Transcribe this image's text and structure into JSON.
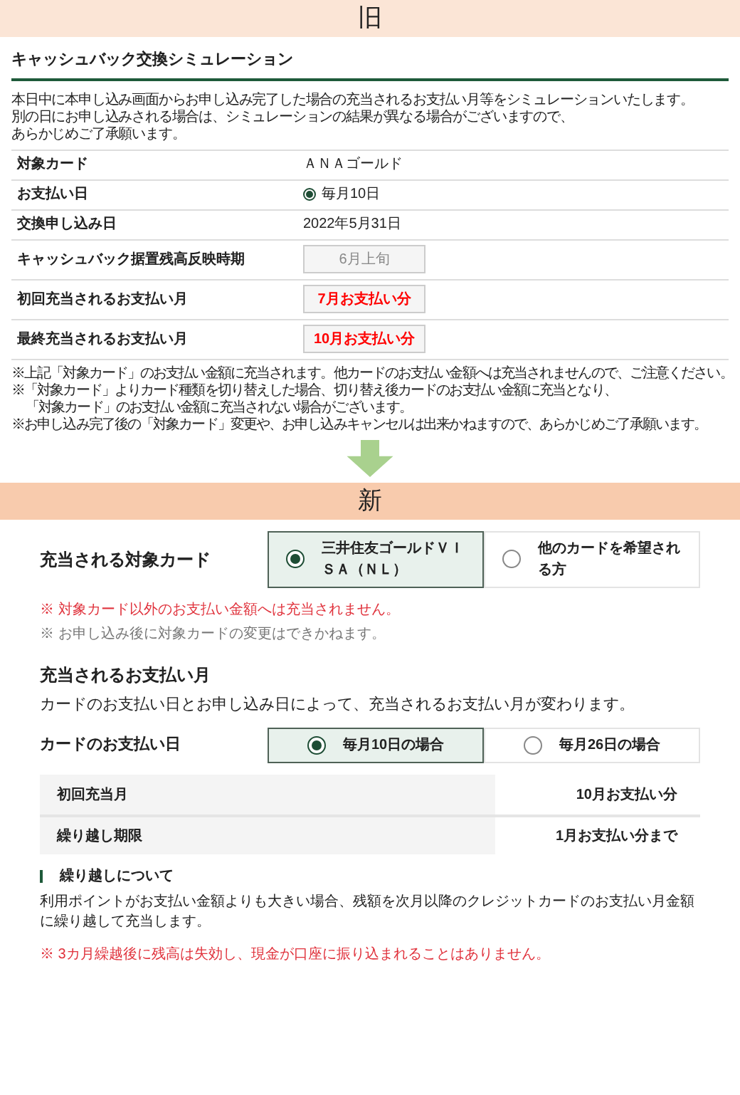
{
  "old": {
    "banner": "旧",
    "title": "キャッシュバック交換シミュレーション",
    "intro": [
      "本日中に本申し込み画面からお申し込み完了した場合の充当されるお支払い月等をシミュレーションいたします。",
      "別の日にお申し込みされる場合は、シミュレーションの結果が異なる場合がございますので、",
      "あらかじめご了承願います。"
    ],
    "rows": [
      {
        "kind": "text",
        "label": "対象カード",
        "value": "ＡＮＡゴールド"
      },
      {
        "kind": "radio",
        "label": "お支払い日",
        "value": "毎月10日",
        "selected": true
      },
      {
        "kind": "text",
        "label": "交換申し込み日",
        "value": "2022年5月31日"
      },
      {
        "kind": "box",
        "label": "キャッシュバック据置残高反映時期",
        "value": "6月上旬",
        "emphasis": false
      },
      {
        "kind": "box",
        "label": "初回充当されるお支払い月",
        "value": "7月お支払い分",
        "emphasis": true
      },
      {
        "kind": "box",
        "label": "最終充当されるお支払い月",
        "value": "10月お支払い分",
        "emphasis": true
      }
    ],
    "notes": [
      {
        "lines": [
          "※上記「対象カード」のお支払い金額に充当されます。他カードのお支払い金額へは充当されませんので、ご注意ください。"
        ]
      },
      {
        "lines": [
          "※「対象カード」よりカード種類を切り替えした場合、切り替え後カードのお支払い金額に充当となり、",
          "「対象カード」のお支払い金額に充当されない場合がございます。"
        ]
      },
      {
        "lines": [
          "※お申し込み完了後の「対象カード」変更や、お申し込みキャンセルは出来かねますので、あらかじめご了承願います。"
        ]
      }
    ]
  },
  "new": {
    "banner": "新",
    "card": {
      "label": "充当される対象カード",
      "options": [
        {
          "label": "三井住友ゴールドＶＩＳＡ（ＮＬ）",
          "selected": true
        },
        {
          "label": "他のカードを希望される方",
          "selected": false
        }
      ],
      "notes": [
        {
          "kind": "warning",
          "text": "※ 対象カード以外のお支払い金額へは充当されません。"
        },
        {
          "kind": "info",
          "text": "※ お申し込み後に対象カードの変更はできかねます。"
        }
      ]
    },
    "payment": {
      "heading": "充当されるお支払い月",
      "description": "カードのお支払い日とお申し込み日によって、充当されるお支払い月が変わります。",
      "payday": {
        "label": "カードのお支払い日",
        "options": [
          {
            "label": "毎月10日の場合",
            "selected": true
          },
          {
            "label": "毎月26日の場合",
            "selected": false
          }
        ]
      },
      "results": [
        {
          "label": "初回充当月",
          "value": "10月お支払い分"
        },
        {
          "label": "繰り越し期限",
          "value": "1月お支払い分まで"
        }
      ]
    },
    "carryover": {
      "heading": "繰り越しについて",
      "body": "利用ポイントがお支払い金額よりも大きい場合、残額を次月以降のクレジットカードのお支払い月金額に繰り越して充当します。",
      "warning": "※ 3カ月繰越後に残高は失効し、現金が口座に振り込まれることはありません。"
    }
  }
}
